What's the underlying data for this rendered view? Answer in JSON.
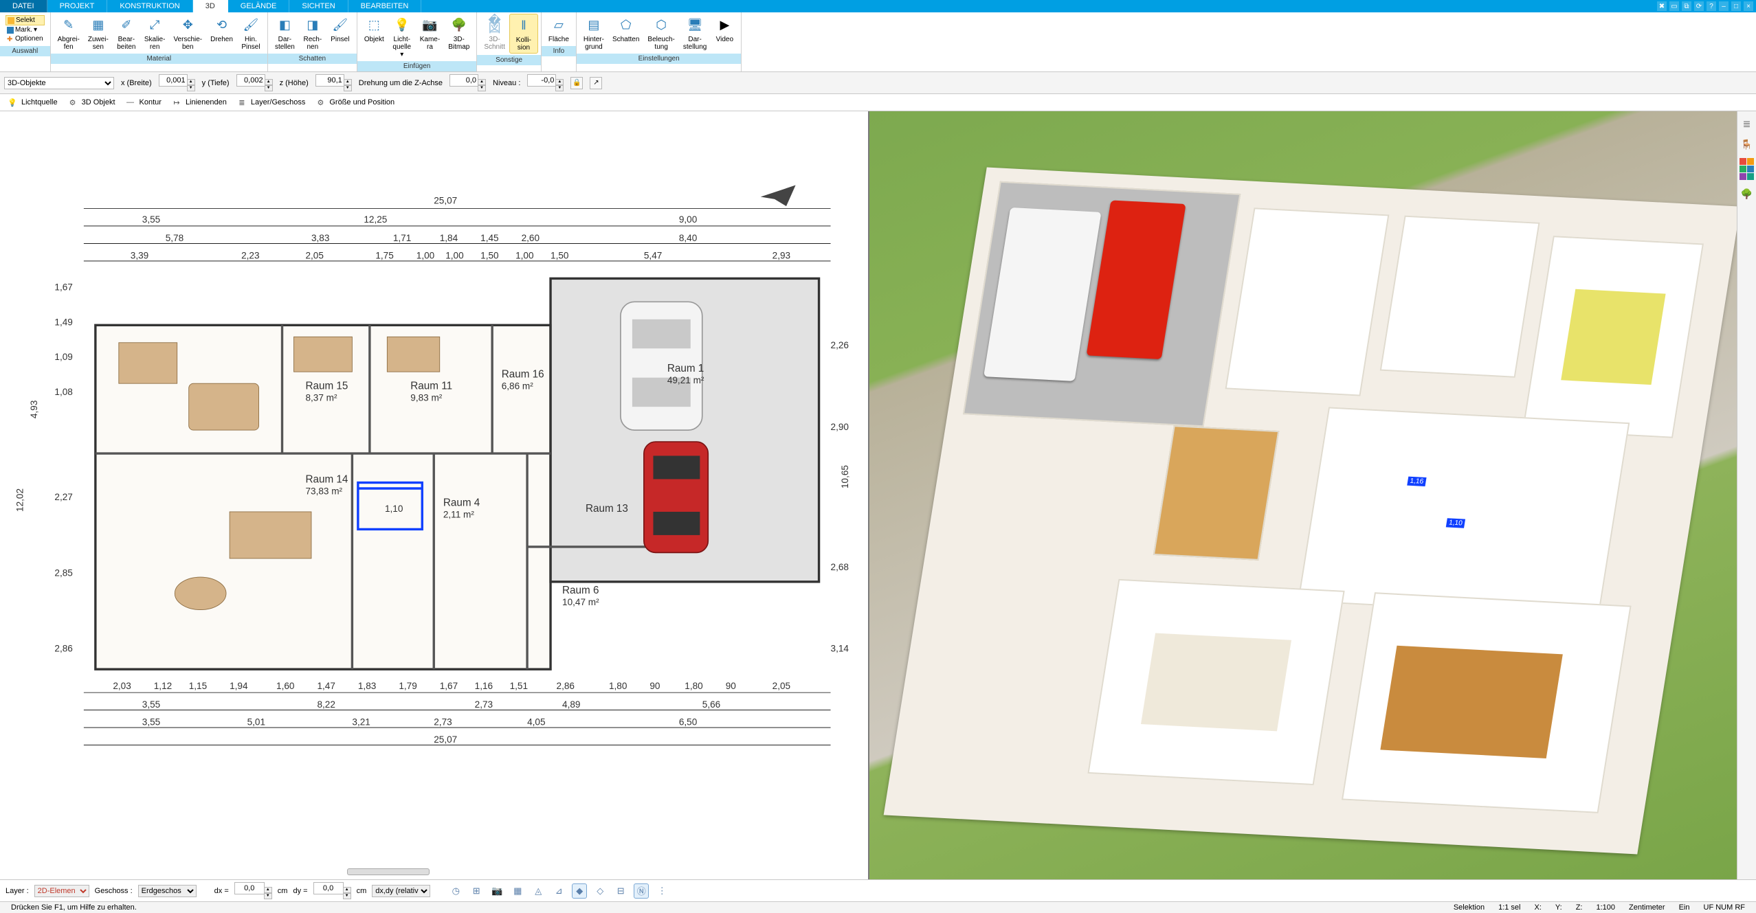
{
  "tabs": {
    "datei": "DATEI",
    "projekt": "PROJEKT",
    "konstruktion": "KONSTRUKTION",
    "d3": "3D",
    "gelaende": "GELÄNDE",
    "sichten": "SICHTEN",
    "bearbeiten": "BEARBEITEN"
  },
  "selcol": {
    "selekt": "Selekt",
    "mark": "Mark.",
    "optionen": "Optionen"
  },
  "ribbon": {
    "auswahl": "Auswahl",
    "material": {
      "title": "Material",
      "abgreifen": "Abgrei-\nfen",
      "zuweisen": "Zuwei-\nsen",
      "bearbeiten": "Bear-\nbeiten",
      "skalieren": "Skalie-\nren",
      "verschieben": "Verschie-\nben",
      "drehen": "Drehen",
      "hinpinsel": "Hin.\nPinsel"
    },
    "schatten": {
      "title": "Schatten",
      "darstellen": "Dar-\nstellen",
      "rechnen": "Rech-\nnen",
      "pinsel": "Pinsel"
    },
    "einfuegen": {
      "title": "Einfügen",
      "objekt": "Objekt",
      "lichtquelle": "Licht-\nquelle",
      "kamera": "Kame-\nra",
      "bitmap": "3D-\nBitmap"
    },
    "sonstige": {
      "title": "Sonstige",
      "schnitt": "3D-\nSchnitt",
      "kollision": "Kolli-\nsion"
    },
    "info": {
      "title": "Info",
      "flaeche": "Fläche"
    },
    "einstellungen": {
      "title": "Einstellungen",
      "hintergrund": "Hinter-\ngrund",
      "schatten": "Schatten",
      "beleuchtung": "Beleuch-\ntung",
      "darstellung": "Dar-\nstellung",
      "video": "Video"
    }
  },
  "prop": {
    "objektart": "3D-Objekte",
    "xlabel": "x (Breite)",
    "x": "0,001",
    "ylabel": "y (Tiefe)",
    "y": "0,002",
    "zlabel": "z (Höhe)",
    "z": "90,1",
    "rotlabel": "Drehung um die Z-Achse",
    "rot": "0,0",
    "nivlabel": "Niveau :",
    "niv": "-0,0"
  },
  "tb2": {
    "licht": "Lichtquelle",
    "obj": "3D Objekt",
    "kontur": "Kontur",
    "linien": "Linienenden",
    "layer": "Layer/Geschoss",
    "groesse": "Größe und Position"
  },
  "plan": {
    "outer": "25,07",
    "dimsTop": [
      "3,55",
      "12,25",
      "9,00"
    ],
    "dimsTop2": [
      "5,78",
      "3,83",
      "1,71",
      "1,84",
      "1,45",
      "2,60",
      "8,40"
    ],
    "dimsTop3": [
      "3,39",
      "2,23",
      "2,05",
      "1,75",
      "1,00",
      "1,00",
      "1,50",
      "1,00",
      "1,50",
      "5,47",
      "2,93"
    ],
    "leftDims": [
      "1,67",
      "1,49",
      "1,09",
      "1,08",
      "4,93",
      "12,02",
      "2,27",
      "2,85",
      "2,86"
    ],
    "rightDims": [
      "2,26",
      "2,90",
      "10,65",
      "2,68",
      "3,14"
    ],
    "rooms": [
      {
        "name": "Raum 15",
        "area": "8,37 m²"
      },
      {
        "name": "Raum 11",
        "area": "9,83 m²"
      },
      {
        "name": "Raum 16",
        "area": "6,86 m²"
      },
      {
        "name": "Raum 1",
        "area": "49,21 m²"
      },
      {
        "name": "Raum 14",
        "area": "73,83 m²"
      },
      {
        "name": "Raum 4",
        "area": "2,11 m²"
      },
      {
        "name": "Raum 13",
        "area": ""
      },
      {
        "name": "Raum 6",
        "area": "10,47 m²"
      }
    ],
    "dimsBot1": [
      "2,03",
      "1,12",
      "1,15",
      "1,94",
      "1,60",
      "1,47",
      "1,83",
      "1,79",
      "1,67",
      "1,16",
      "1,51",
      "2,86",
      "1,80",
      "90",
      "1,80",
      "90",
      "2,05"
    ],
    "dimsBot2": [
      "3,55",
      "8,22",
      "2,73",
      "4,89",
      "5,66"
    ],
    "dimsBot3": [
      "3,55",
      "5,01",
      "3,21",
      "2,73",
      "4,05",
      "6,50"
    ],
    "selDim": "1,10"
  },
  "view3d": {
    "m1": "1,16",
    "m2": "1,10"
  },
  "bottom": {
    "layerlbl": "Layer :",
    "layer": "2D-Elemen",
    "geschosslbl": "Geschoss :",
    "geschoss": "Erdgeschos",
    "dxlbl": "dx =",
    "dx": "0,0",
    "cm": "cm",
    "dylbl": "dy =",
    "dy": "0,0",
    "hint": "dx,dy (relativ ka"
  },
  "status": {
    "help": "Drücken Sie F1, um Hilfe zu erhalten.",
    "sel": "Selektion",
    "ratio": "1:1 sel",
    "x": "X:",
    "y": "Y:",
    "z": "Z:",
    "scale": "1:100",
    "unit": "Zentimeter",
    "ein": "Ein",
    "num": "UF  NUM  RF"
  }
}
